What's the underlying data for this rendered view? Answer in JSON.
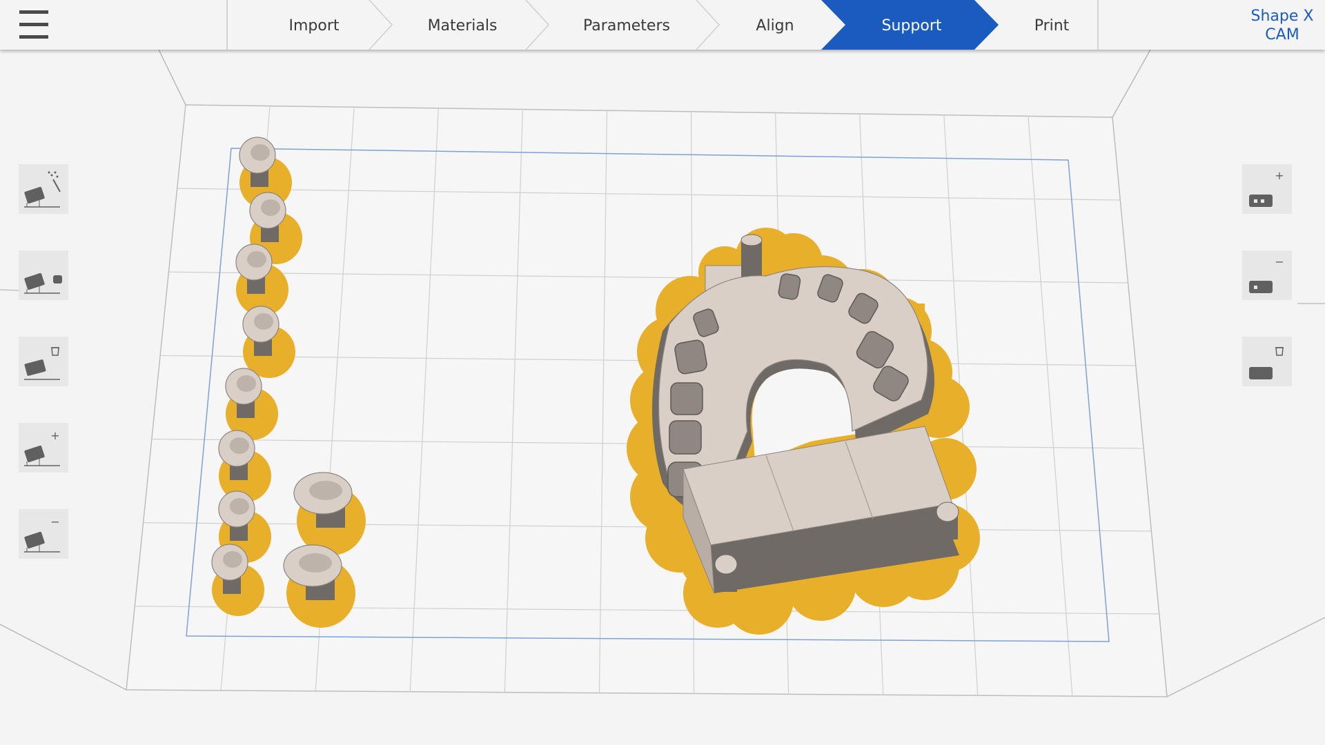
{
  "app": {
    "name_line1": "Shape X",
    "name_line2": "CAM"
  },
  "steps": [
    {
      "label": "Import",
      "active": false
    },
    {
      "label": "Materials",
      "active": false
    },
    {
      "label": "Parameters",
      "active": false
    },
    {
      "label": "Align",
      "active": false
    },
    {
      "label": "Support",
      "active": true
    },
    {
      "label": "Print",
      "active": false
    }
  ],
  "colors": {
    "accent": "#1a5bbf",
    "support": "#e8b02a",
    "model": "#d9cfc6",
    "model_shadow": "#6f6a66",
    "background": "#f4f4f4",
    "grid": "#cfcfcf",
    "build_area_outline": "#7ea0d6"
  },
  "left_tools": [
    {
      "icon": "auto-support-icon",
      "badge": "wand"
    },
    {
      "icon": "support-point-icon",
      "badge": "dot"
    },
    {
      "icon": "delete-support-icon",
      "badge": "trash"
    },
    {
      "icon": "add-support-icon",
      "badge": "+"
    },
    {
      "icon": "remove-support-icon",
      "badge": "−"
    }
  ],
  "right_tools": [
    {
      "icon": "increase-density-icon",
      "badge": "+"
    },
    {
      "icon": "decrease-density-icon",
      "badge": "−"
    },
    {
      "icon": "clear-supports-icon",
      "badge": "trash"
    }
  ]
}
